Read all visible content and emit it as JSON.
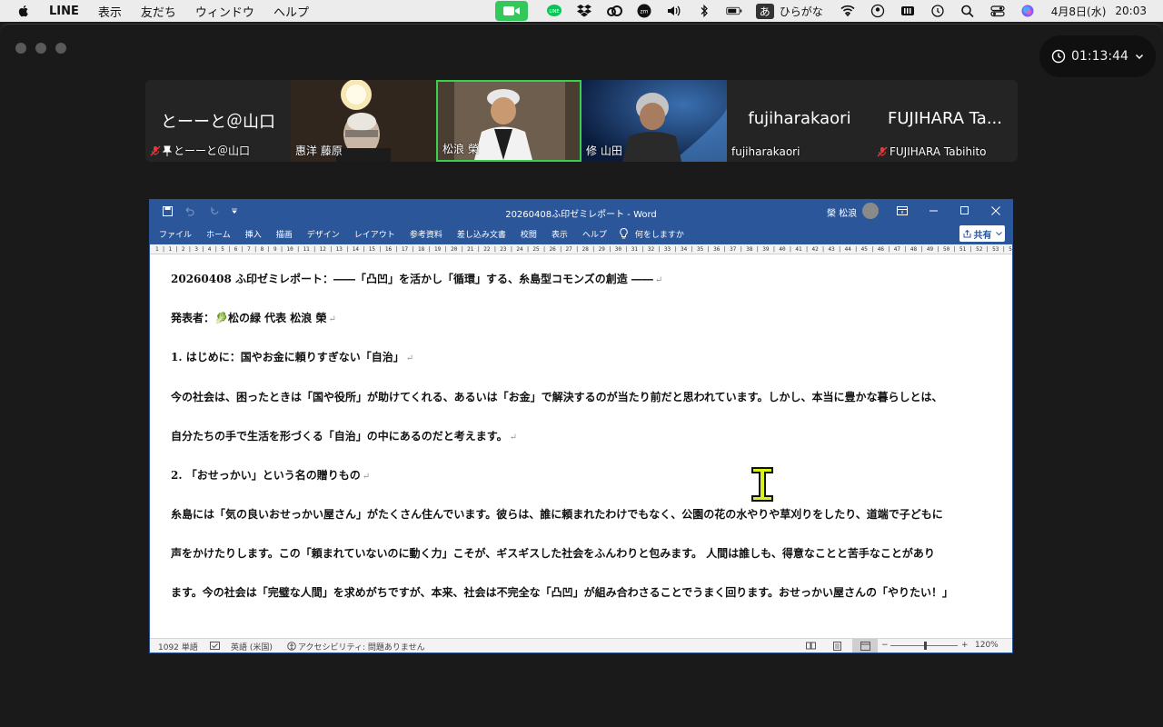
{
  "menubar": {
    "items": [
      "LINE",
      "表示",
      "友だち",
      "ウィンドウ",
      "ヘルプ"
    ],
    "ime_label": "ひらがな",
    "ime_char": "あ",
    "date": "4月8日(水)",
    "time": "20:03"
  },
  "zoom": {
    "timer": "01:13:44",
    "participants": [
      {
        "big_name": "とーーと＠山口",
        "label": "とーーと＠山口",
        "muted": true,
        "pinned": true,
        "video": false
      },
      {
        "big_name": "",
        "label": "惠洋 藤原",
        "muted": false,
        "pinned": false,
        "video": true
      },
      {
        "big_name": "",
        "label": "松浪 榮",
        "muted": false,
        "pinned": false,
        "video": true,
        "active": true
      },
      {
        "big_name": "",
        "label": "修 山田",
        "muted": false,
        "pinned": false,
        "video": true
      },
      {
        "big_name": "fujiharakaori",
        "label": "fujiharakaori",
        "muted": false,
        "pinned": false,
        "video": false
      },
      {
        "big_name": "FUJIHARA Ta...",
        "label": "FUJIHARA Tabihito",
        "muted": true,
        "pinned": false,
        "video": false
      }
    ]
  },
  "word": {
    "title": "20260408ふ印ゼミレポート  -  Word",
    "user": "榮 松浪",
    "tabs": [
      "ファイル",
      "ホーム",
      "挿入",
      "描画",
      "デザイン",
      "レイアウト",
      "参考資料",
      "差し込み文書",
      "校閲",
      "表示",
      "ヘルプ",
      "何をしますか"
    ],
    "share_label": "共有",
    "ruler": "1 | 1 | 2 | 3 | 4 | 5 | 6 | 7 | 8 | 9 | 10 | 11 | 12 | 13 | 14 | 15 | 16 | 17 | 18 | 19 | 20 | 21 | 22 | 23 | 24 | 25 | 26 | 27 | 28 | 29 | 30 | 31 | 32 | 33 | 34 | 35 | 36 | 37 | 38 | 39 | 40 | 41 | 42 | 43 | 44 | 45 | 46 | 47 | 48 | 49 | 50 | 51 | 52 | 53 | 54 | 55 | 56 | 57 | 58 | 59 | 60 | 61 | 62 | 63 | 64 | 65 | 66 | 67 | 68 | 69 | 70 | 71 | 72",
    "lines": [
      "20260408 ふ印ゼミレポート：――「凸凹」を活かし「循環」する、糸島型コモンズの創造 ――",
      "発表者：🥬松の緑 代表 松浪 榮",
      "1. はじめに：国やお金に頼りすぎない「自治」",
      "今の社会は、困ったときは「国や役所」が助けてくれる、あるいは「お金」で解決するのが当たり前だと思われています。しかし、本当に豊かな暮らしとは、",
      "自分たちの手で生活を形づくる「自治」の中にあるのだと考えます。",
      "2. 「おせっかい」という名の贈りもの",
      "糸島には「気の良いおせっかい屋さん」がたくさん住んでいます。彼らは、誰に頼まれたわけでもなく、公園の花の水やりや草刈りをしたり、道端で子どもに",
      "声をかけたりします。この「頼まれていないのに動く力」こそが、ギスギスした社会をふんわりと包みます。 人間は誰しも、得意なことと苦手なことがあり",
      "ます。今の社会は「完璧な人間」を求めがちですが、本来、社会は不完全な「凸凹」が組み合わさることでうまく回ります。おせっかい屋さんの「やりたい！」"
    ],
    "status": {
      "word_count": "1092 単語",
      "language": "英語 (米国)",
      "accessibility": "アクセシビリティ: 問題ありません",
      "zoom": "120%"
    }
  }
}
